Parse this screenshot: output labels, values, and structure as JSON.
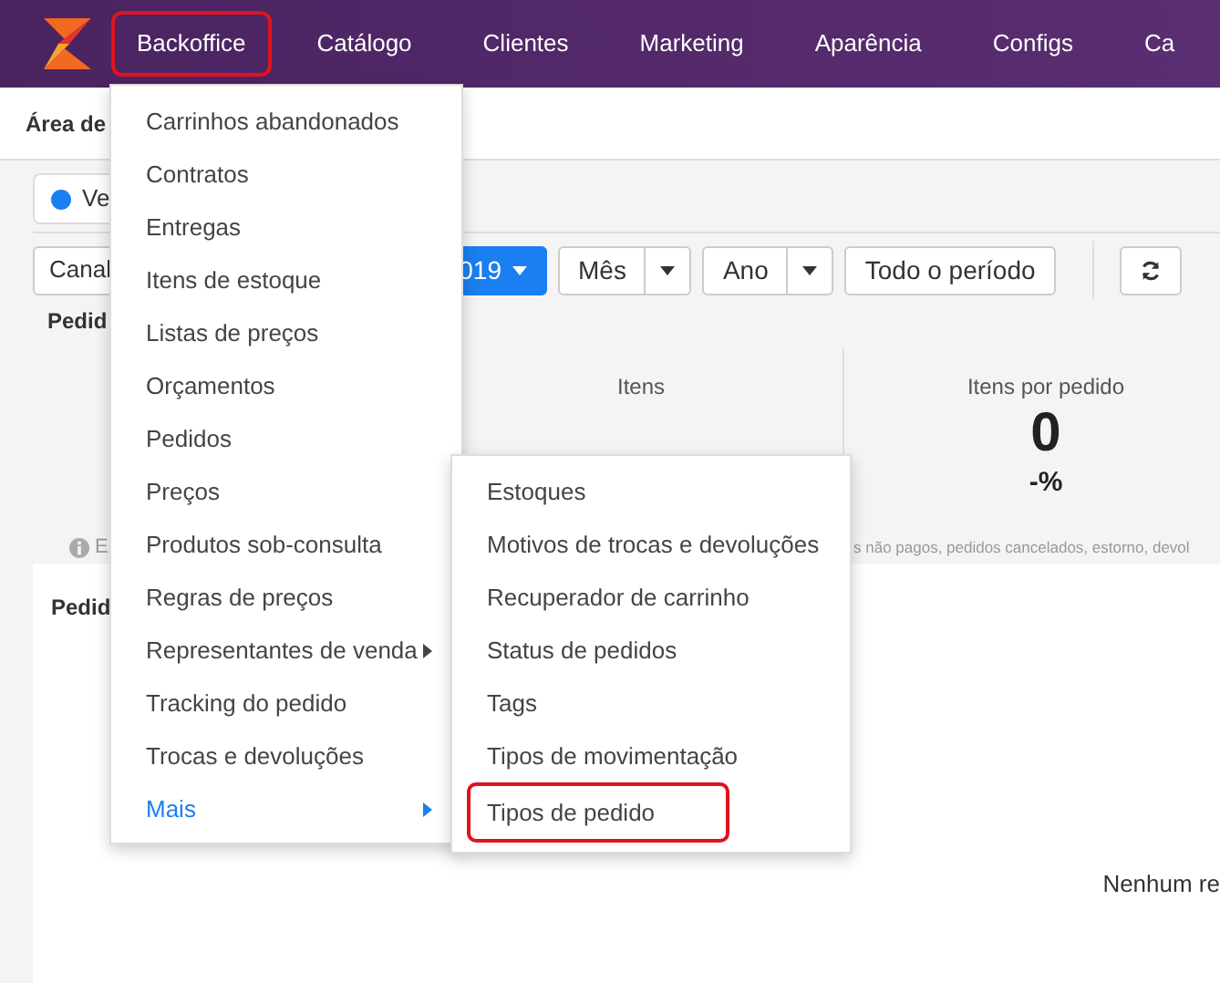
{
  "navbar": {
    "items": [
      {
        "label": "Backoffice",
        "highlighted": true
      },
      {
        "label": "Catálogo",
        "highlighted": false
      },
      {
        "label": "Clientes",
        "highlighted": false
      },
      {
        "label": "Marketing",
        "highlighted": false
      },
      {
        "label": "Aparência",
        "highlighted": false
      },
      {
        "label": "Configs",
        "highlighted": false
      },
      {
        "label": "Ca",
        "highlighted": false
      }
    ]
  },
  "header": {
    "title": "Área de"
  },
  "filter_chip": {
    "label": "Ve",
    "selected": true
  },
  "toolbar": {
    "channel": "Canal",
    "period": "019",
    "month": "Mês",
    "year": "Ano",
    "all_time": "Todo o período"
  },
  "summary": {
    "title": "Pedid",
    "stats": [
      {
        "label": "Itens"
      },
      {
        "label": "Itens por pedido",
        "value": "0",
        "change": "-%"
      }
    ]
  },
  "info_note": {
    "start": "E",
    "end": "s não pagos, pedidos cancelados, estorno, devol"
  },
  "orders_card": {
    "title": "Pedid",
    "empty_message": "Nenhum re"
  },
  "menu": {
    "items": [
      {
        "label": "Carrinhos abandonados",
        "has_submenu": false,
        "active": false
      },
      {
        "label": "Contratos",
        "has_submenu": false,
        "active": false
      },
      {
        "label": "Entregas",
        "has_submenu": false,
        "active": false
      },
      {
        "label": "Itens de estoque",
        "has_submenu": false,
        "active": false
      },
      {
        "label": "Listas de preços",
        "has_submenu": false,
        "active": false
      },
      {
        "label": "Orçamentos",
        "has_submenu": false,
        "active": false
      },
      {
        "label": "Pedidos",
        "has_submenu": false,
        "active": false
      },
      {
        "label": "Preços",
        "has_submenu": false,
        "active": false
      },
      {
        "label": "Produtos sob-consulta",
        "has_submenu": false,
        "active": false
      },
      {
        "label": "Regras de preços",
        "has_submenu": false,
        "active": false
      },
      {
        "label": "Representantes de venda",
        "has_submenu": true,
        "active": false
      },
      {
        "label": "Tracking do pedido",
        "has_submenu": false,
        "active": false
      },
      {
        "label": "Trocas e devoluções",
        "has_submenu": false,
        "active": false
      },
      {
        "label": "Mais",
        "has_submenu": true,
        "active": true
      }
    ]
  },
  "submenu": {
    "items": [
      {
        "label": "Estoques",
        "highlighted": false
      },
      {
        "label": "Motivos de trocas e devoluções",
        "highlighted": false
      },
      {
        "label": "Recuperador de carrinho",
        "highlighted": false
      },
      {
        "label": "Status de pedidos",
        "highlighted": false
      },
      {
        "label": "Tags",
        "highlighted": false
      },
      {
        "label": "Tipos de movimentação",
        "highlighted": false
      },
      {
        "label": "Tipos de pedido",
        "highlighted": true
      }
    ]
  }
}
